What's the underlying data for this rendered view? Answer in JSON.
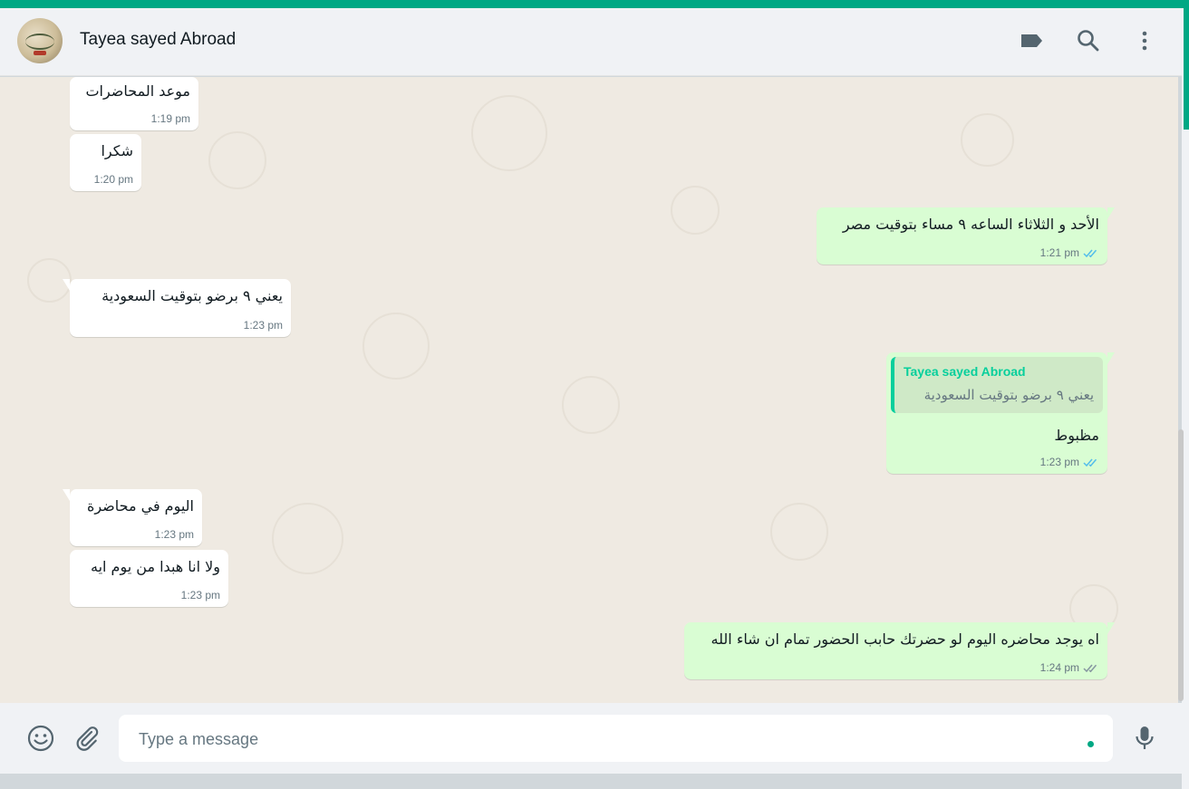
{
  "header": {
    "contact_name": "Tayea sayed Abroad",
    "icons": [
      "label-icon",
      "search-icon",
      "menu-icon"
    ]
  },
  "messages": [
    {
      "direction": "in",
      "text": "موعد المحاضرات",
      "time": "1:19 pm"
    },
    {
      "direction": "in",
      "text": "شكرا",
      "time": "1:20 pm"
    },
    {
      "direction": "out",
      "text": "الأحد و الثلاثاء الساعه ٩ مساء بتوقيت مصر",
      "time": "1:21 pm",
      "status": "read"
    },
    {
      "direction": "in",
      "text": "يعني ٩ برضو بتوقيت السعودية",
      "time": "1:23 pm"
    },
    {
      "direction": "out",
      "text": "مظبوط",
      "time": "1:23 pm",
      "status": "read",
      "quote": {
        "author": "Tayea sayed Abroad",
        "text": "يعني ٩ برضو بتوقيت السعودية"
      }
    },
    {
      "direction": "in",
      "text": "اليوم في محاضرة",
      "time": "1:23 pm"
    },
    {
      "direction": "in",
      "text": "ولا انا هبدا من يوم ايه",
      "time": "1:23 pm"
    },
    {
      "direction": "out",
      "text": "اه يوجد محاضره اليوم لو حضرتك حابب الحضور تمام ان شاء الله",
      "time": "1:24 pm",
      "status": "delivered"
    }
  ],
  "composer": {
    "placeholder": "Type a message",
    "icons": [
      "emoji-icon",
      "attach-icon",
      "mic-icon"
    ]
  },
  "colors": {
    "accent": "#00a884",
    "incoming_bubble": "#ffffff",
    "outgoing_bubble": "#d9fdd3",
    "read_ticks": "#53bdeb",
    "delivered_ticks": "#8696a0",
    "chat_background": "#efeae2"
  }
}
